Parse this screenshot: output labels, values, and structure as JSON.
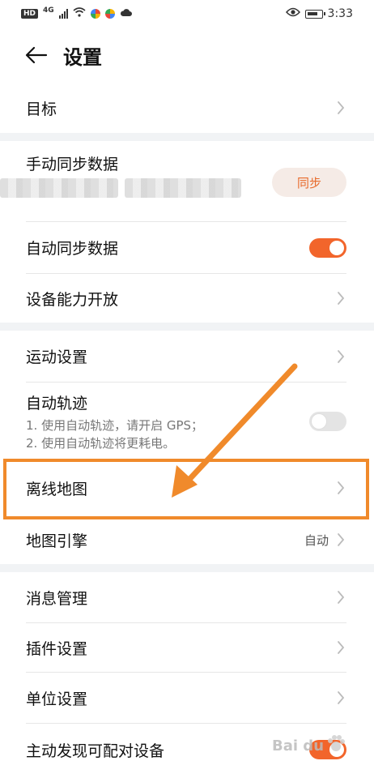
{
  "status_bar": {
    "network_badge": "HD",
    "network_type": "4G",
    "time": "3:33"
  },
  "header": {
    "title": "设置"
  },
  "section1": {
    "goal_label": "目标"
  },
  "section2": {
    "manual_sync_label": "手动同步数据",
    "sync_button_label": "同步",
    "auto_sync_label": "自动同步数据",
    "auto_sync_on": true,
    "device_capability_label": "设备能力开放"
  },
  "section3": {
    "sport_settings_label": "运动设置",
    "auto_track_label": "自动轨迹",
    "auto_track_note1": "1. 使用自动轨迹，请开启 GPS；",
    "auto_track_note2": "2. 使用自动轨迹将更耗电。",
    "auto_track_on": false,
    "offline_map_label": "离线地图",
    "map_engine_label": "地图引擎",
    "map_engine_value": "自动"
  },
  "section4": {
    "message_mgmt_label": "消息管理",
    "plugin_settings_label": "插件设置",
    "unit_settings_label": "单位设置",
    "discover_device_label": "主动发现可配对设备"
  },
  "watermark": {
    "text": "Bai du"
  },
  "colors": {
    "accent": "#f2652b",
    "annotation": "#f08a2b"
  }
}
